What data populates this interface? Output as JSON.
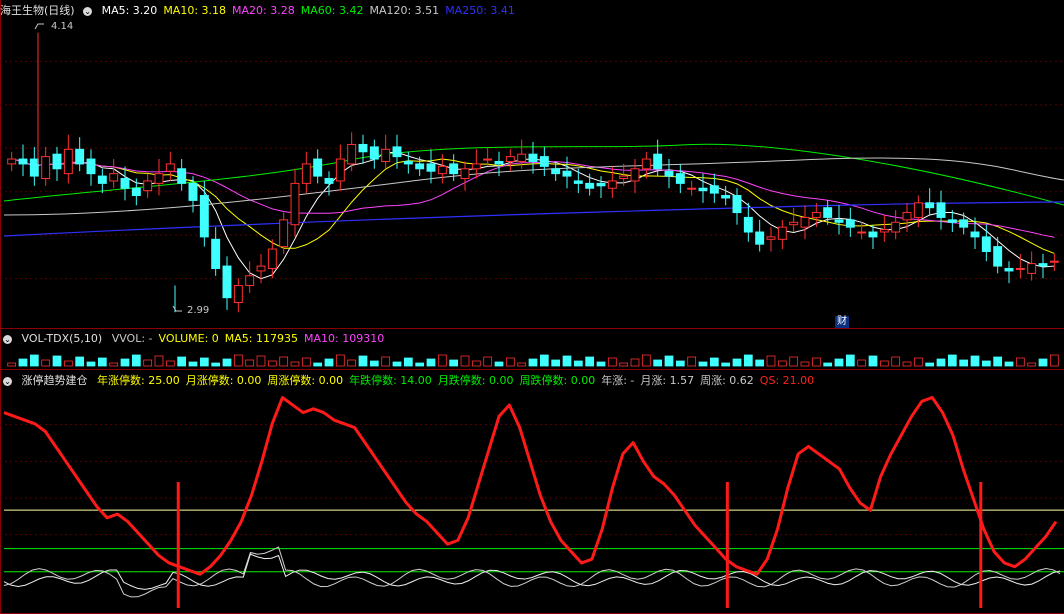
{
  "main": {
    "title": "海王生物(日线)",
    "ma": [
      {
        "label": "MA5: 3.20",
        "color": "#ffffff"
      },
      {
        "label": "MA10: 3.18",
        "color": "#ffff00"
      },
      {
        "label": "MA20: 3.28",
        "color": "#ff44ff"
      },
      {
        "label": "MA60: 3.42",
        "color": "#00ee00"
      },
      {
        "label": "MA120: 3.51",
        "color": "#c8c8c8"
      },
      {
        "label": "MA250: 3.41",
        "color": "#3030ff"
      }
    ],
    "high_label": "4.14",
    "low_label": "2.99",
    "fin_badge": "财"
  },
  "vol": {
    "title": "VOL-TDX(5,10)",
    "fields": [
      {
        "label": "VVOL: -",
        "color": "#c8c8c8"
      },
      {
        "label": "VOLUME: 0",
        "color": "#ffff00"
      },
      {
        "label": "MA5: 117935",
        "color": "#ffff00"
      },
      {
        "label": "MA10: 109310",
        "color": "#ff44ff"
      }
    ]
  },
  "ind": {
    "title": "涨停趋势建仓",
    "fields": [
      {
        "label": "年涨停数: 25.00",
        "color": "#ffff00"
      },
      {
        "label": "月涨停数: 0.00",
        "color": "#ffff00"
      },
      {
        "label": "周涨停数: 0.00",
        "color": "#ffff00"
      },
      {
        "label": "年跌停数: 14.00",
        "color": "#00ee00"
      },
      {
        "label": "月跌停数: 0.00",
        "color": "#00ee00"
      },
      {
        "label": "周跌停数: 0.00",
        "color": "#00ee00"
      },
      {
        "label": "年涨: -",
        "color": "#c8c8c8"
      },
      {
        "label": "月涨: 1.57",
        "color": "#c8c8c8"
      },
      {
        "label": "周涨: 0.62",
        "color": "#c8c8c8"
      },
      {
        "label": "QS: 21.00",
        "color": "#ff2020"
      }
    ]
  },
  "chart_data": {
    "type": "candlestick",
    "price_range": [
      2.95,
      4.2
    ],
    "high": 4.14,
    "low": 2.99,
    "closes": [
      3.62,
      3.6,
      3.55,
      3.63,
      3.58,
      3.66,
      3.6,
      3.56,
      3.52,
      3.56,
      3.5,
      3.47,
      3.53,
      3.56,
      3.6,
      3.52,
      3.45,
      3.3,
      3.17,
      3.05,
      3.1,
      3.14,
      3.18,
      3.25,
      3.37,
      3.52,
      3.6,
      3.55,
      3.52,
      3.62,
      3.68,
      3.65,
      3.62,
      3.66,
      3.63,
      3.6,
      3.58,
      3.57,
      3.59,
      3.56,
      3.58,
      3.6,
      3.62,
      3.6,
      3.63,
      3.64,
      3.61,
      3.59,
      3.56,
      3.55,
      3.52,
      3.5,
      3.51,
      3.53,
      3.55,
      3.58,
      3.62,
      3.58,
      3.55,
      3.52,
      3.5,
      3.49,
      3.48,
      3.46,
      3.4,
      3.32,
      3.27,
      3.3,
      3.34,
      3.36,
      3.38,
      3.4,
      3.38,
      3.36,
      3.34,
      3.32,
      3.3,
      3.33,
      3.36,
      3.4,
      3.44,
      3.42,
      3.38,
      3.36,
      3.34,
      3.3,
      3.24,
      3.18,
      3.16,
      3.17,
      3.19,
      3.18,
      3.2
    ],
    "ma_series": [
      "MA5",
      "MA10",
      "MA20",
      "MA60",
      "MA120",
      "MA250"
    ],
    "indicator": {
      "qs_line": [
        88,
        86,
        84,
        82,
        78,
        70,
        62,
        54,
        46,
        38,
        32,
        34,
        30,
        24,
        18,
        12,
        8,
        6,
        4,
        2,
        6,
        12,
        20,
        30,
        44,
        62,
        82,
        96,
        92,
        88,
        90,
        88,
        84,
        82,
        80,
        72,
        64,
        56,
        48,
        40,
        34,
        30,
        24,
        18,
        20,
        32,
        50,
        68,
        86,
        92,
        80,
        62,
        44,
        30,
        20,
        14,
        8,
        10,
        26,
        48,
        66,
        72,
        62,
        54,
        50,
        44,
        36,
        28,
        22,
        16,
        10,
        6,
        4,
        2,
        10,
        26,
        48,
        66,
        70,
        66,
        62,
        58,
        48,
        40,
        36,
        54,
        66,
        76,
        86,
        94,
        96,
        88,
        76,
        58,
        42,
        26,
        14,
        8,
        6,
        10,
        16,
        22,
        30
      ],
      "buy_signals_at": [
        0.165,
        0.685,
        0.925
      ],
      "levels": [
        0.555,
        0.73,
        0.835
      ]
    }
  }
}
